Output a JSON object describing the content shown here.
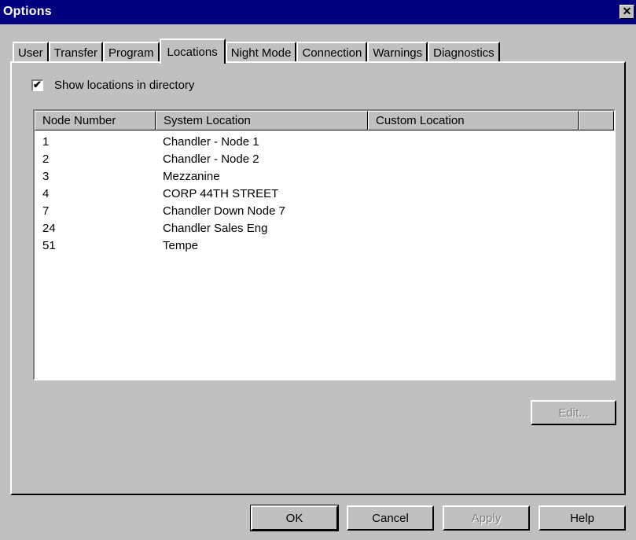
{
  "window": {
    "title": "Options",
    "close_glyph": "✕"
  },
  "tabs": [
    {
      "label": "User"
    },
    {
      "label": "Transfer"
    },
    {
      "label": "Program"
    },
    {
      "label": "Locations"
    },
    {
      "label": "Night Mode"
    },
    {
      "label": "Connection"
    },
    {
      "label": "Warnings"
    },
    {
      "label": "Diagnostics"
    }
  ],
  "active_tab": "Locations",
  "show_locations": {
    "label": "Show locations in directory",
    "checked": true,
    "check_glyph": "✔"
  },
  "list": {
    "columns": [
      "Node Number",
      "System Location",
      "Custom Location",
      ""
    ],
    "rows": [
      {
        "node": "1",
        "system": "Chandler - Node 1",
        "custom": ""
      },
      {
        "node": "2",
        "system": "Chandler - Node 2",
        "custom": ""
      },
      {
        "node": "3",
        "system": "Mezzanine",
        "custom": ""
      },
      {
        "node": "4",
        "system": "CORP 44TH STREET",
        "custom": ""
      },
      {
        "node": "7",
        "system": "Chandler Down Node 7",
        "custom": ""
      },
      {
        "node": "24",
        "system": "Chandler Sales Eng",
        "custom": ""
      },
      {
        "node": "51",
        "system": "Tempe",
        "custom": ""
      }
    ]
  },
  "buttons": {
    "edit": "Edit...",
    "ok": "OK",
    "cancel": "Cancel",
    "apply": "Apply",
    "help": "Help"
  }
}
